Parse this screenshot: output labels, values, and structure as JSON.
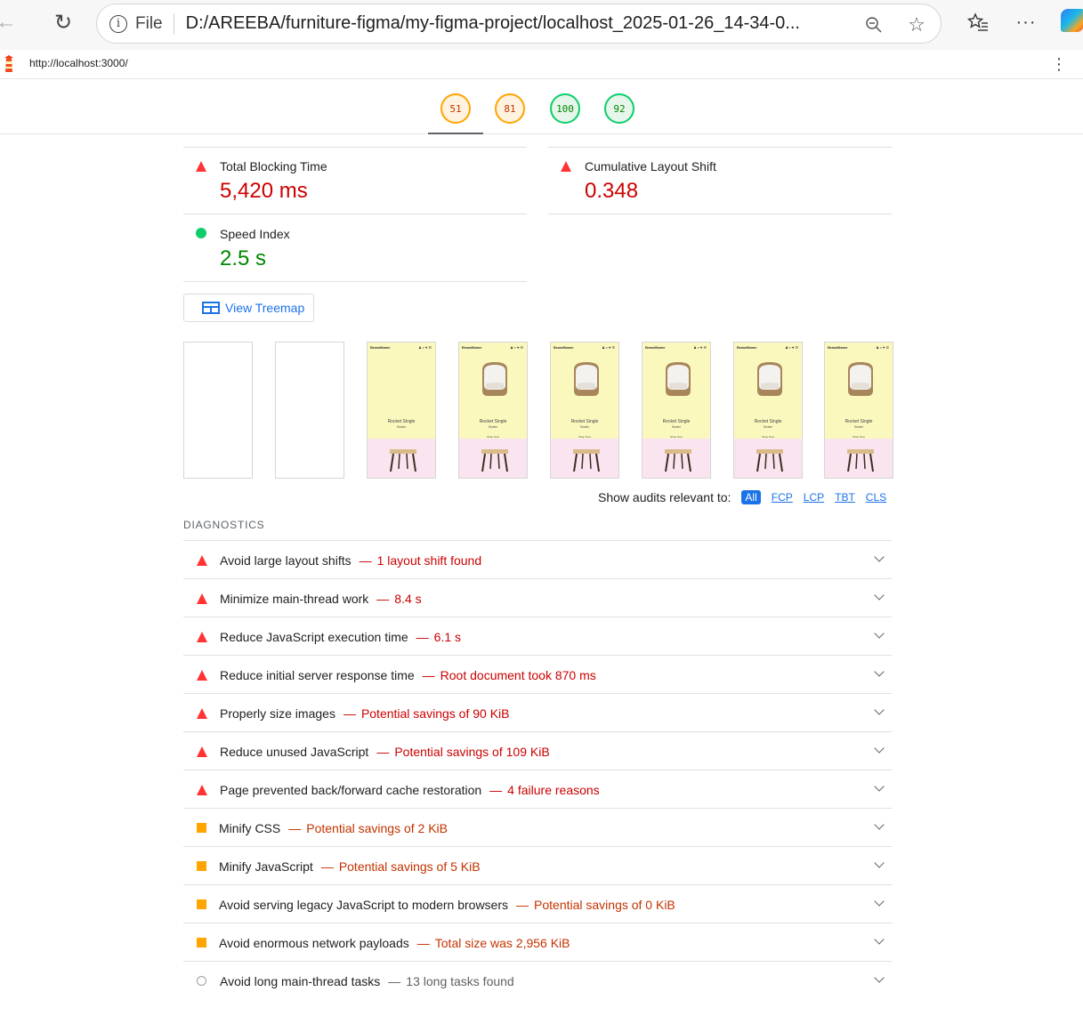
{
  "browser": {
    "file_label": "File",
    "address": "D:/AREEBA/furniture-figma/my-figma-project/localhost_2025-01-26_14-34-0...",
    "icons": [
      "back-icon",
      "reload-icon",
      "info-icon",
      "zoom-out-icon",
      "star-icon",
      "favorites-icon",
      "more-icon",
      "copilot-icon"
    ]
  },
  "report": {
    "url": "http://localhost:3000/",
    "scores": [
      {
        "value": "51",
        "rating": "average"
      },
      {
        "value": "81",
        "rating": "average"
      },
      {
        "value": "100",
        "rating": "pass"
      },
      {
        "value": "92",
        "rating": "pass"
      }
    ]
  },
  "metrics": [
    {
      "title": "Total Blocking Time",
      "value": "5,420 ms",
      "rating": "fail"
    },
    {
      "title": "Cumulative Layout Shift",
      "value": "0.348",
      "rating": "fail"
    },
    {
      "title": "Speed Index",
      "value": "2.5 s",
      "rating": "pass"
    }
  ],
  "treemap_button": "View Treemap",
  "filmstrip": {
    "brand": "BrandName",
    "product_title": "Rocket Single",
    "product_subtitle": "Seater",
    "shop_link": "Shop Now"
  },
  "filter": {
    "label": "Show audits relevant to:",
    "options": [
      "All",
      "FCP",
      "LCP",
      "TBT",
      "CLS"
    ],
    "selected": "All"
  },
  "diagnostics": {
    "heading": "DIAGNOSTICS",
    "audits": [
      {
        "title": "Avoid large layout shifts",
        "detail": "1 layout shift found",
        "rating": "fail"
      },
      {
        "title": "Minimize main-thread work",
        "detail": "8.4 s",
        "rating": "fail"
      },
      {
        "title": "Reduce JavaScript execution time",
        "detail": "6.1 s",
        "rating": "fail"
      },
      {
        "title": "Reduce initial server response time",
        "detail": "Root document took 870 ms",
        "rating": "fail"
      },
      {
        "title": "Properly size images",
        "detail": "Potential savings of 90 KiB",
        "rating": "fail"
      },
      {
        "title": "Reduce unused JavaScript",
        "detail": "Potential savings of 109 KiB",
        "rating": "fail"
      },
      {
        "title": "Page prevented back/forward cache restoration",
        "detail": "4 failure reasons",
        "rating": "fail"
      },
      {
        "title": "Minify CSS",
        "detail": "Potential savings of 2 KiB",
        "rating": "average"
      },
      {
        "title": "Minify JavaScript",
        "detail": "Potential savings of 5 KiB",
        "rating": "average"
      },
      {
        "title": "Avoid serving legacy JavaScript to modern browsers",
        "detail": "Potential savings of 0 KiB",
        "rating": "average"
      },
      {
        "title": "Avoid enormous network payloads",
        "detail": "Total size was 2,956 KiB",
        "rating": "average"
      },
      {
        "title": "Avoid long main-thread tasks",
        "detail": "13 long tasks found",
        "rating": "neutral"
      }
    ]
  },
  "colors": {
    "fail": "#cc0000",
    "average": "#c33300",
    "pass": "#008800",
    "accent": "#1a73e8"
  }
}
